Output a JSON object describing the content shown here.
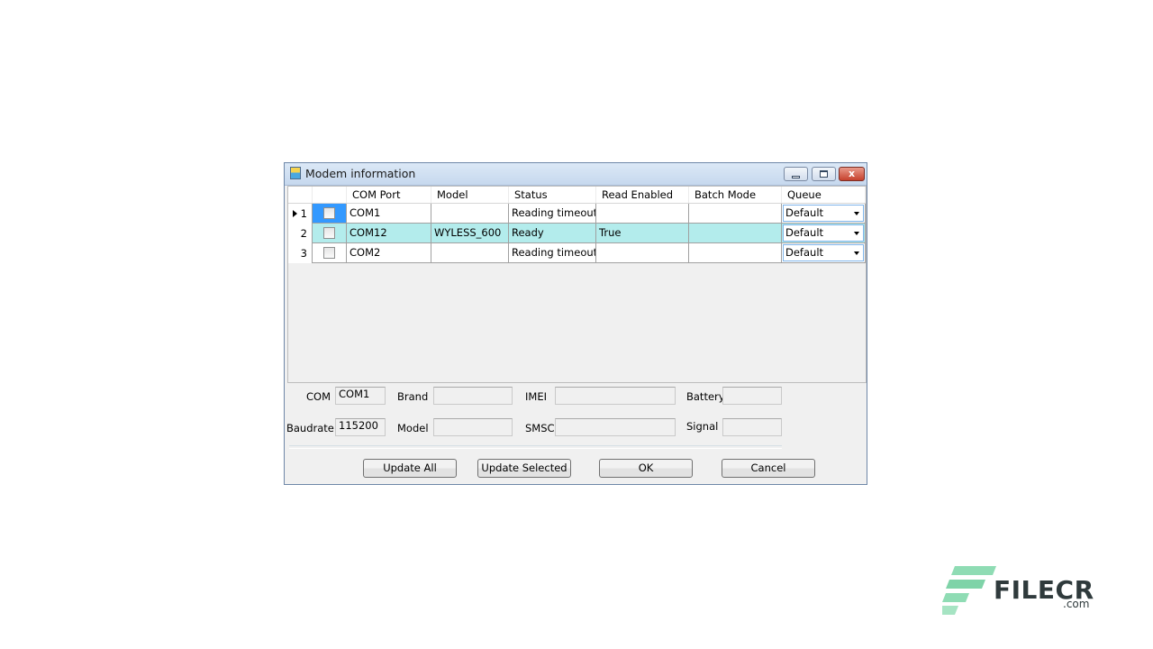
{
  "window": {
    "title": "Modem information",
    "close_glyph": "x"
  },
  "grid": {
    "columns": [
      "COM Port",
      "Model",
      "Status",
      "Read Enabled",
      "Batch Mode",
      "Queue"
    ],
    "rows": [
      {
        "index": "1",
        "com_port": "COM1",
        "model": "",
        "status": "Reading timeout",
        "read_enabled": "",
        "batch_mode": "",
        "queue": "Default"
      },
      {
        "index": "2",
        "com_port": "COM12",
        "model": "WYLESS_600",
        "status": "Ready",
        "read_enabled": "True",
        "batch_mode": "",
        "queue": "Default"
      },
      {
        "index": "3",
        "com_port": "COM2",
        "model": "",
        "status": "Reading timeout",
        "read_enabled": "",
        "batch_mode": "",
        "queue": "Default"
      }
    ]
  },
  "info": {
    "com_label": "COM",
    "com_value": "COM1",
    "brand_label": "Brand",
    "brand_value": "",
    "imei_label": "IMEI",
    "imei_value": "",
    "battery_label": "Battery",
    "battery_value": "",
    "baudrate_label": "Baudrate",
    "baudrate_value": "115200",
    "model_label": "Model",
    "model_value": "",
    "smsc_label": "SMSC",
    "smsc_value": "",
    "signal_label": "Signal",
    "signal_value": ""
  },
  "buttons": {
    "update_all": "Update All",
    "update_selected": "Update Selected",
    "ok": "OK",
    "cancel": "Cancel"
  },
  "watermark": {
    "brand": "FILECR",
    "suffix": ".com",
    "colors": {
      "mark": "#7fd3a8",
      "text": "#2f3a3c"
    }
  }
}
